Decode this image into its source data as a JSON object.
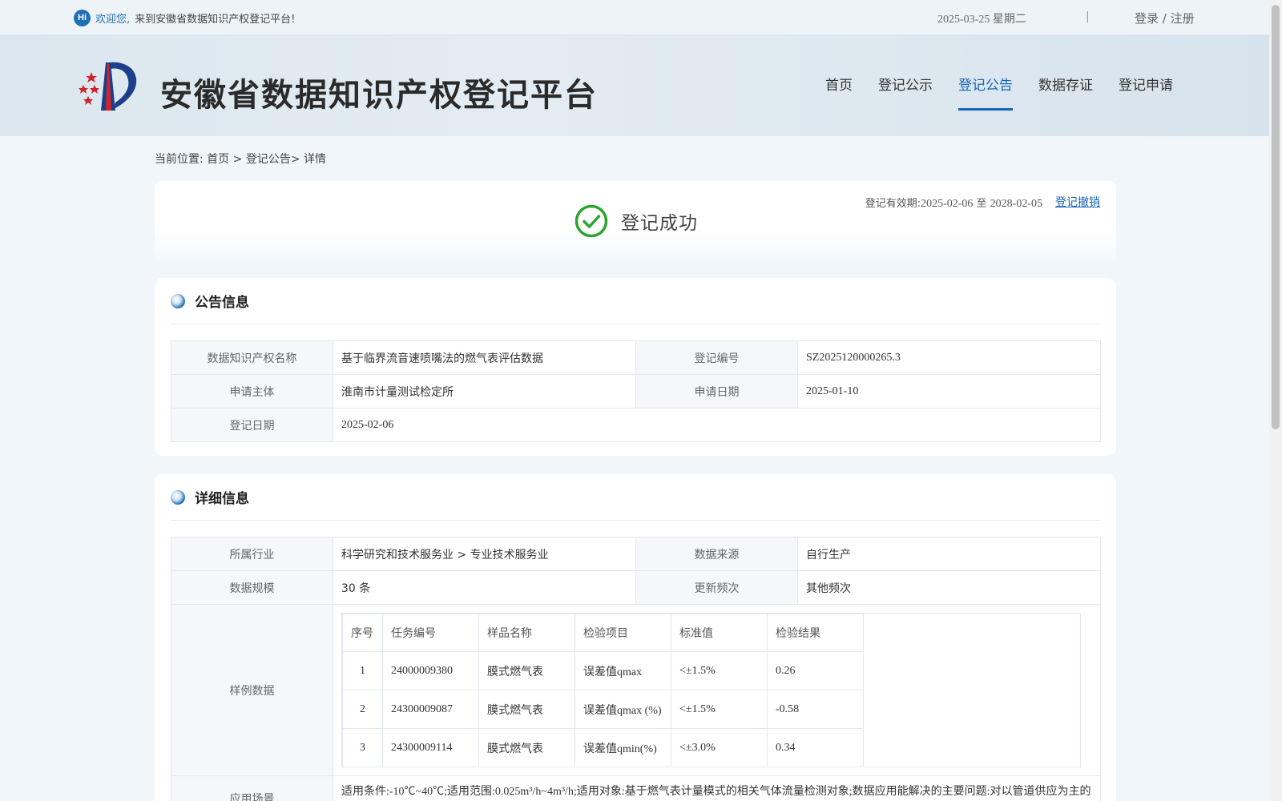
{
  "topbar": {
    "hi": "Hi",
    "welcome_highlight": "欢迎您,",
    "welcome_text": "来到安徽省数据知识产权登记平台!",
    "date": "2025-03-25 星期二",
    "separator": "|",
    "login": "登录",
    "slash": " / ",
    "register": "注册"
  },
  "header": {
    "site_title": "安徽省数据知识产权登记平台",
    "nav": [
      {
        "label": "首页"
      },
      {
        "label": "登记公示"
      },
      {
        "label": "登记公告"
      },
      {
        "label": "数据存证"
      },
      {
        "label": "登记申请"
      }
    ],
    "active_nav": "登记公告"
  },
  "breadcrumb": {
    "prefix": "当前位置:",
    "home": "首页",
    "sep1": " > ",
    "section": "登记公告",
    "sep2": "> ",
    "current": "详情"
  },
  "status": {
    "valid_label": "登记有效期:",
    "valid_from": "2025-02-06",
    "valid_to_word": " 至 ",
    "valid_to": "2028-02-05",
    "revoke": "登记撤销",
    "success_text": "登记成功",
    "success_color": "#2aa52e"
  },
  "announcement": {
    "title": "公告信息",
    "rows": {
      "name_label": "数据知识产权名称",
      "name_value": "基于临界流音速喷嘴法的燃气表评估数据",
      "reg_no_label": "登记编号",
      "reg_no_value": "SZ2025120000265.3",
      "applicant_label": "申请主体",
      "applicant_value": "淮南市计量测试检定所",
      "apply_date_label": "申请日期",
      "apply_date_value": "2025-01-10",
      "reg_date_label": "登记日期",
      "reg_date_value": "2025-02-06"
    }
  },
  "details": {
    "title": "详细信息",
    "rows": {
      "industry_label": "所属行业",
      "industry_value": "科学研究和技术服务业 > 专业技术服务业",
      "source_label": "数据来源",
      "source_value": "自行生产",
      "scale_label": "数据规模",
      "scale_value": "30 条",
      "freq_label": "更新频次",
      "freq_value": "其他频次",
      "sample_label": "样例数据",
      "scenario_label": "应用场景",
      "scenario_value": "适用条件:-10℃~40℃;适用范围:0.025m³/h~4m³/h;适用对象:基于燃气表计量模式的相关气体流量检测对象;数据应用能解决的主要问题:对以管道供应为主的"
    },
    "sample_table": {
      "headers": [
        "序号",
        "任务编号",
        "样品名称",
        "检验项目",
        "标准值",
        "检验结果"
      ],
      "rows": [
        [
          "1",
          "24000009380",
          "膜式燃气表",
          "误差值qmax",
          "<±1.5%",
          "0.26"
        ],
        [
          "2",
          "24300009087",
          "膜式燃气表",
          "误差值qmax (%)",
          "<±1.5%",
          "-0.58"
        ],
        [
          "3",
          "24300009114",
          "膜式燃气表",
          "误差值qmin(%)",
          "<±3.0%",
          "0.34"
        ]
      ]
    }
  },
  "colors": {
    "accent": "#1766b5",
    "background": "#f1f6fa"
  }
}
